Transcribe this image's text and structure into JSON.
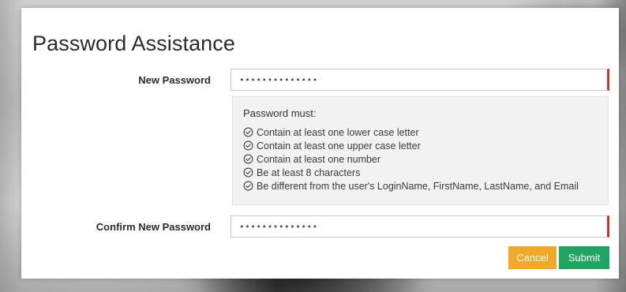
{
  "page": {
    "title": "Password Assistance"
  },
  "form": {
    "new_password": {
      "label": "New Password",
      "value": "••••••••••••••"
    },
    "confirm_password": {
      "label": "Confirm New Password",
      "value": "••••••••••••••"
    },
    "invalid_indicator_color": "#c0392b"
  },
  "requirements": {
    "heading": "Password must:",
    "icon": "circle-check-icon",
    "items": [
      "Contain at least one lower case letter",
      "Contain at least one upper case letter",
      "Contain at least one number",
      "Be at least 8 characters",
      "Be different from the user's LoginName, FirstName, LastName, and Email"
    ]
  },
  "actions": {
    "cancel_label": "Cancel",
    "submit_label": "Submit",
    "cancel_color": "#f0a929",
    "submit_color": "#1fa561"
  }
}
